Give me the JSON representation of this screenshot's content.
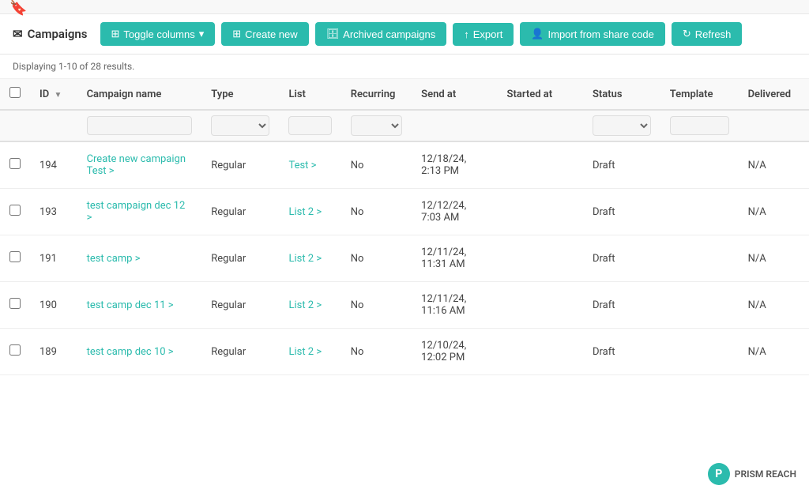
{
  "topStrip": {
    "bookmarkIcon": "🔖"
  },
  "header": {
    "title": "Campaigns",
    "emailIcon": "✉",
    "buttons": {
      "toggleColumns": "Toggle columns",
      "createNew": "Create new",
      "archivedCampaigns": "Archived campaigns",
      "export": "Export",
      "importFromShareCode": "Import from share code",
      "refresh": "Refresh"
    }
  },
  "subHeader": {
    "displayText": "Displaying 1-10 of 28 results."
  },
  "table": {
    "columns": [
      {
        "key": "checkbox",
        "label": ""
      },
      {
        "key": "id",
        "label": "ID"
      },
      {
        "key": "campaignName",
        "label": "Campaign name"
      },
      {
        "key": "type",
        "label": "Type"
      },
      {
        "key": "list",
        "label": "List"
      },
      {
        "key": "recurring",
        "label": "Recurring"
      },
      {
        "key": "sendAt",
        "label": "Send at"
      },
      {
        "key": "startedAt",
        "label": "Started at"
      },
      {
        "key": "status",
        "label": "Status"
      },
      {
        "key": "template",
        "label": "Template"
      },
      {
        "key": "delivered",
        "label": "Delivered"
      }
    ],
    "rows": [
      {
        "id": "194",
        "campaignName": "Create new campaign Test >",
        "type": "Regular",
        "list": "Test >",
        "recurring": "No",
        "sendAt": "12/18/24, 2:13 PM",
        "startedAt": "",
        "status": "Draft",
        "template": "",
        "delivered": "N/A"
      },
      {
        "id": "193",
        "campaignName": "test campaign dec 12 >",
        "type": "Regular",
        "list": "List 2 >",
        "recurring": "No",
        "sendAt": "12/12/24, 7:03 AM",
        "startedAt": "",
        "status": "Draft",
        "template": "",
        "delivered": "N/A"
      },
      {
        "id": "191",
        "campaignName": "test camp >",
        "type": "Regular",
        "list": "List 2 >",
        "recurring": "No",
        "sendAt": "12/11/24, 11:31 AM",
        "startedAt": "",
        "status": "Draft",
        "template": "",
        "delivered": "N/A"
      },
      {
        "id": "190",
        "campaignName": "test camp dec 11 >",
        "type": "Regular",
        "list": "List 2 >",
        "recurring": "No",
        "sendAt": "12/11/24, 11:16 AM",
        "startedAt": "",
        "status": "Draft",
        "template": "",
        "delivered": "N/A"
      },
      {
        "id": "189",
        "campaignName": "test camp dec 10 >",
        "type": "Regular",
        "list": "List 2 >",
        "recurring": "No",
        "sendAt": "12/10/24, 12:02 PM",
        "startedAt": "",
        "status": "Draft",
        "template": "",
        "delivered": "N/A"
      }
    ],
    "filterPlaceholders": {
      "campaignName": "",
      "type": "",
      "list": "",
      "recurring": "",
      "status": ""
    }
  },
  "brand": {
    "name": "PRISM REACH",
    "logoLetter": "P"
  }
}
